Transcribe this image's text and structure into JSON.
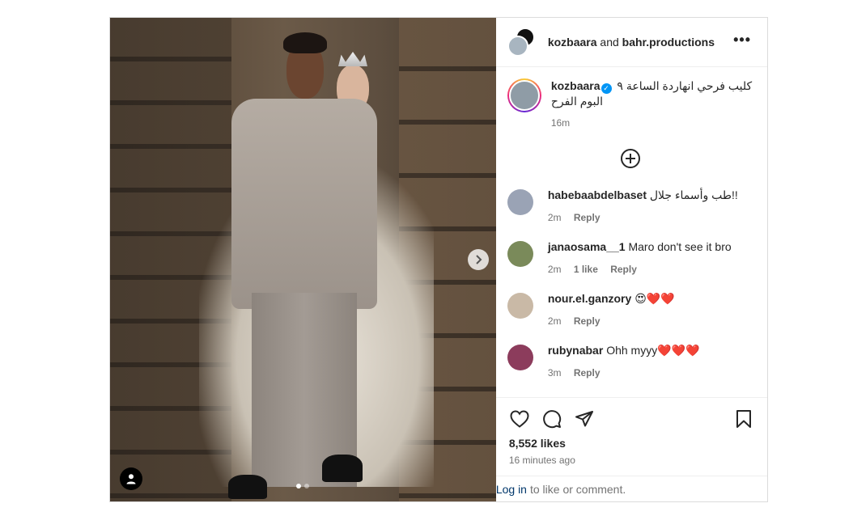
{
  "post": {
    "media": {
      "tag_icon": "user-tag-icon",
      "next_icon": "chevron-right-icon",
      "carousel_count": 2,
      "carousel_active_index": 0
    },
    "header": {
      "account": "kozbaara",
      "joiner": "and",
      "collaborator": "bahr.productions",
      "more": "•••"
    },
    "caption": {
      "username": "kozbaara",
      "verified_glyph": "✓",
      "text_line1": "كليب فرحي انهاردة الساعة ٩",
      "text_line2": "البوم الفرح",
      "time": "16m"
    },
    "load_more_icon": "plus-circle-icon",
    "comments": [
      {
        "username": "habebaabdelbaset",
        "text": "طب وأسماء جلال!!",
        "time": "2m",
        "likes": "",
        "reply": "Reply",
        "avatar_color": "#9aa3b5"
      },
      {
        "username": "janaosama__1",
        "text": "Maro don't see it bro",
        "time": "2m",
        "likes": "1 like",
        "reply": "Reply",
        "avatar_color": "#7a8a5a"
      },
      {
        "username": "nour.el.ganzory",
        "text": "😍❤️❤️",
        "time": "2m",
        "likes": "",
        "reply": "Reply",
        "avatar_color": "#c9b9a6"
      },
      {
        "username": "rubynabar",
        "text": "Ohh myyy❤️❤️❤️",
        "time": "3m",
        "likes": "",
        "reply": "Reply",
        "avatar_color": "#8c3c5c"
      }
    ],
    "actions": {
      "like_icon": "heart-icon",
      "comment_icon": "comment-icon",
      "share_icon": "share-icon",
      "save_icon": "bookmark-icon"
    },
    "likes_count": "8,552 likes",
    "posted_time": "16 minutes ago",
    "login": {
      "link": "Log in",
      "rest": "to like or comment."
    }
  }
}
